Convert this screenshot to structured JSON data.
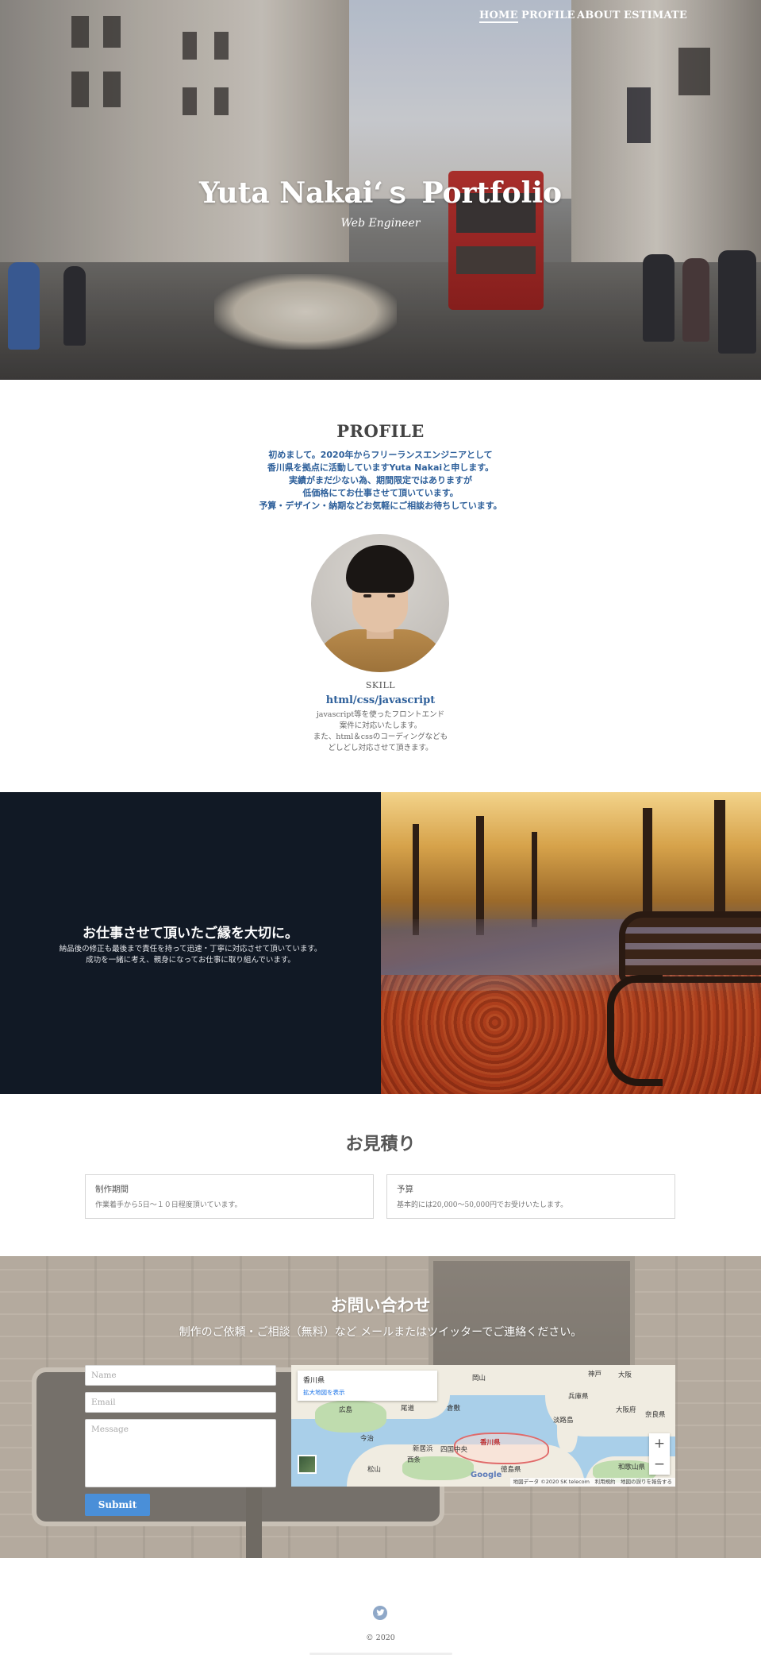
{
  "nav": {
    "items": [
      {
        "label": "HOME",
        "active": true
      },
      {
        "label": "PROFILE",
        "active": false
      },
      {
        "label": "ABOUT",
        "active": false
      },
      {
        "label": "ESTIMATE",
        "active": false
      }
    ]
  },
  "hero": {
    "title": "Yuta Nakai‘ｓ Portfolio",
    "subtitle": "Web Engineer"
  },
  "profile": {
    "title": "PROFILE",
    "intro_lines": [
      "初めまして。2020年からフリーランスエンジニアとして",
      "香川県を拠点に活動していますYuta Nakaiと申します。",
      "実績がまだ少ない為、期間限定ではありますが",
      "低価格にてお仕事させて頂いています。",
      "予算・デザイン・納期などお気軽にご相談お待ちしています。"
    ],
    "avatar_alt": "profile-photo",
    "skill_label": "SKILL",
    "skill_name": "html/css/javascript",
    "skill_desc_lines": [
      "javascript等を使ったフロントエンド",
      "案件に対応いたします。",
      "また、html＆cssのコーディングなども",
      "どしどし対応させて頂きます。"
    ]
  },
  "feature": {
    "title": "お仕事させて頂いたご縁を大切に。",
    "desc_lines": [
      "納品後の修正も最後まで責任を持って迅速・丁寧に対応させて頂いています。",
      "成功を一緒に考え、親身になってお仕事に取り組んでいます。"
    ]
  },
  "estimate": {
    "title": "お見積り",
    "cards": [
      {
        "heading": "制作期間",
        "text": "作業着手から5日～１０日程度頂いています。"
      },
      {
        "heading": "予算",
        "text": "基本的には20,000～50,000円でお受けいたします。"
      }
    ]
  },
  "contact": {
    "title": "お問い合わせ",
    "subtitle": "制作のご依頼・ご相談（無料）など メールまたはツイッターでご連絡ください。",
    "name_placeholder": "Name",
    "email_placeholder": "Email",
    "message_placeholder": "Message",
    "submit_label": "Submit"
  },
  "map": {
    "place": "香川県",
    "view_larger": "拡大地図を表示",
    "labels": [
      "岡山",
      "神戸",
      "大阪",
      "広島",
      "尾道",
      "倉敷",
      "大阪府",
      "奈良県",
      "香川県",
      "今治",
      "西条",
      "新居浜",
      "四国中央",
      "徳島県",
      "和歌山県",
      "松山",
      "淡路島",
      "兵庫県"
    ],
    "zoom_in": "+",
    "zoom_out": "−",
    "google": "Google",
    "attribution": "地図データ ©2020 SK telecom　利用規約　地図の誤りを報告する"
  },
  "footer": {
    "twitter_icon": "twitter-icon",
    "copyright": "© 2020"
  }
}
